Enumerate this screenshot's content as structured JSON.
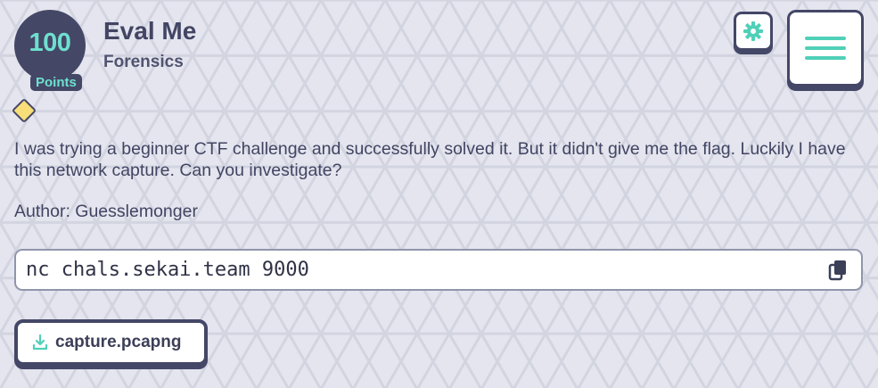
{
  "challenge": {
    "points": "100",
    "points_label": "Points",
    "title": "Eval Me",
    "category": "Forensics",
    "description": "I was trying a beginner CTF challenge and successfully solved it. But it didn't give me the flag. Luckily I have this network capture. Can you investigate?",
    "author": "Author: Guesslemonger",
    "command": "nc chals.sekai.team 9000"
  },
  "attachments": [
    {
      "label": "capture.pcapng",
      "icon": "download-icon"
    }
  ],
  "icons": {
    "settings": "gear-icon",
    "menu": "hamburger-menu-icon",
    "difficulty": "diamond-icon",
    "copy": "copy-icon"
  },
  "colors": {
    "background": "#e4e5ee",
    "dark": "#444766",
    "accent": "#4fd0b8",
    "badge_text": "#6ee0cf",
    "diamond": "#f8de79"
  }
}
